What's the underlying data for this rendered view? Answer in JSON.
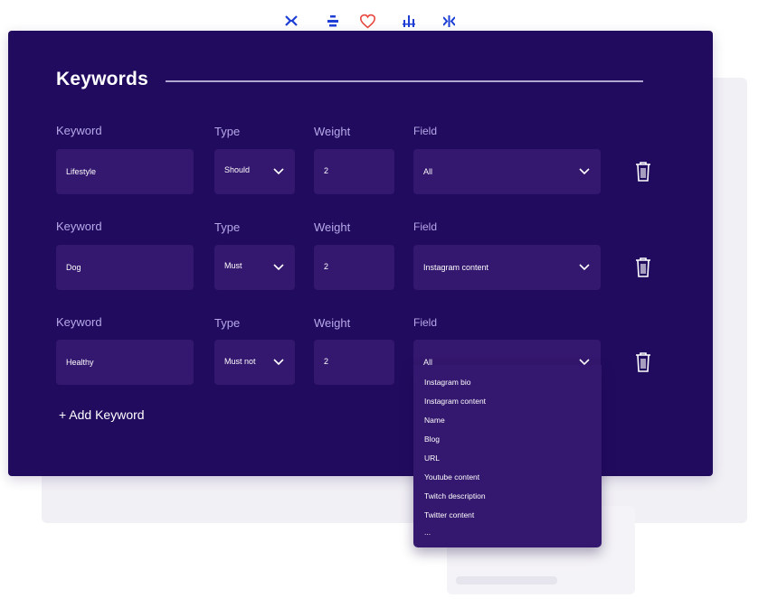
{
  "toolbar": {
    "icons": [
      "collapse-horizontal-icon",
      "align-center-icon",
      "heart-icon",
      "distribute-icon",
      "split-vertical-icon"
    ]
  },
  "section": {
    "title": "Keywords"
  },
  "labels": {
    "keyword": "Keyword",
    "type": "Type",
    "weight": "Weight",
    "field": "Field"
  },
  "rows": [
    {
      "keyword": "Lifestyle",
      "type": "Should",
      "weight": "2",
      "field": "All"
    },
    {
      "keyword": "Dog",
      "type": "Must",
      "weight": "2",
      "field": "Instagram content"
    },
    {
      "keyword": "Healthy",
      "type": "Must not",
      "weight": "2",
      "field": "All"
    }
  ],
  "add_keyword_label": "+ Add Keyword",
  "field_dropdown": {
    "options": [
      "Instagram bio",
      "Instagram content",
      "Name",
      "Blog",
      "URL",
      "Youtube content",
      "Twitch description",
      "Twitter content",
      "..."
    ]
  },
  "colors": {
    "panel": "#210b5f",
    "input": "#34176e",
    "label": "#b6a9e8",
    "toolbar_icon": "#1e3fd6",
    "heart": "#e8453c"
  }
}
